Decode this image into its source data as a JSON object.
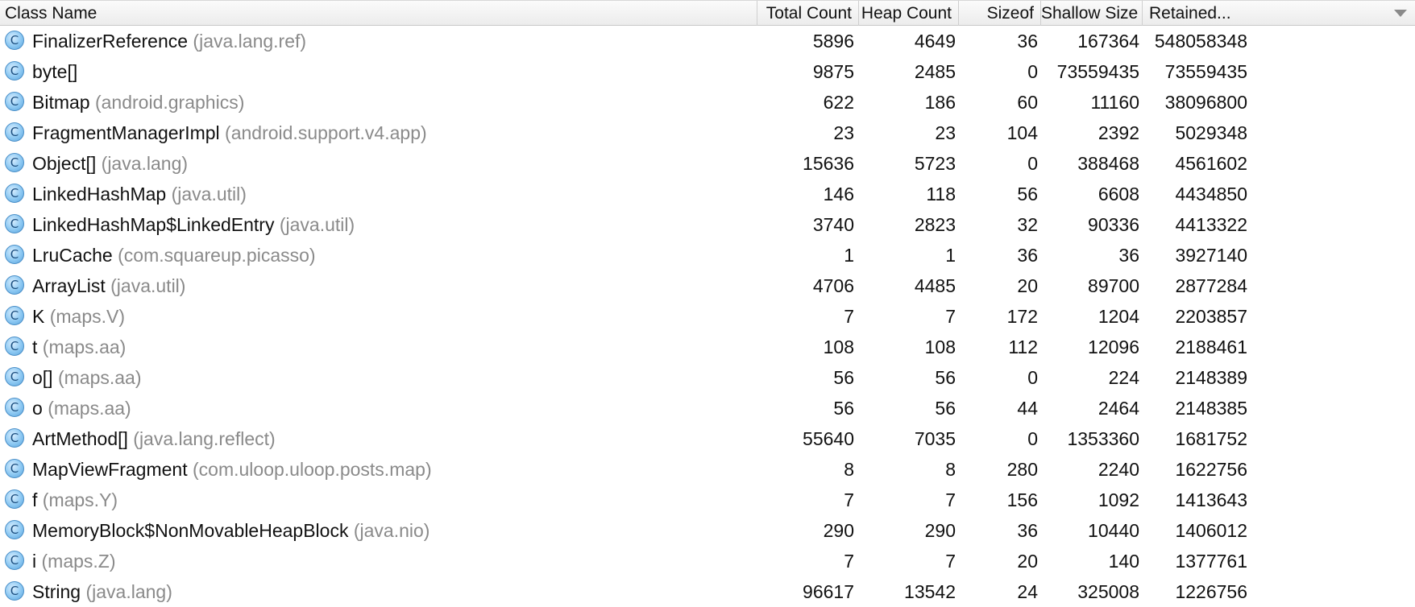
{
  "columns": {
    "class_name": "Class Name",
    "total_count": "Total Count",
    "heap_count": "Heap Count",
    "sizeof": "Sizeof",
    "shallow_size": "Shallow Size",
    "retained": "Retained..."
  },
  "class_icon_glyph": "C",
  "rows": [
    {
      "name": "FinalizerReference",
      "pkg": "(java.lang.ref)",
      "total": "5896",
      "heap": "4649",
      "sizeof": "36",
      "shallow": "167364",
      "retained": "548058348"
    },
    {
      "name": "byte[]",
      "pkg": "",
      "total": "9875",
      "heap": "2485",
      "sizeof": "0",
      "shallow": "73559435",
      "retained": "73559435"
    },
    {
      "name": "Bitmap",
      "pkg": "(android.graphics)",
      "total": "622",
      "heap": "186",
      "sizeof": "60",
      "shallow": "11160",
      "retained": "38096800"
    },
    {
      "name": "FragmentManagerImpl",
      "pkg": "(android.support.v4.app)",
      "total": "23",
      "heap": "23",
      "sizeof": "104",
      "shallow": "2392",
      "retained": "5029348"
    },
    {
      "name": "Object[]",
      "pkg": "(java.lang)",
      "total": "15636",
      "heap": "5723",
      "sizeof": "0",
      "shallow": "388468",
      "retained": "4561602"
    },
    {
      "name": "LinkedHashMap",
      "pkg": "(java.util)",
      "total": "146",
      "heap": "118",
      "sizeof": "56",
      "shallow": "6608",
      "retained": "4434850"
    },
    {
      "name": "LinkedHashMap$LinkedEntry",
      "pkg": "(java.util)",
      "total": "3740",
      "heap": "2823",
      "sizeof": "32",
      "shallow": "90336",
      "retained": "4413322"
    },
    {
      "name": "LruCache",
      "pkg": "(com.squareup.picasso)",
      "total": "1",
      "heap": "1",
      "sizeof": "36",
      "shallow": "36",
      "retained": "3927140"
    },
    {
      "name": "ArrayList",
      "pkg": "(java.util)",
      "total": "4706",
      "heap": "4485",
      "sizeof": "20",
      "shallow": "89700",
      "retained": "2877284"
    },
    {
      "name": "K",
      "pkg": "(maps.V)",
      "total": "7",
      "heap": "7",
      "sizeof": "172",
      "shallow": "1204",
      "retained": "2203857"
    },
    {
      "name": "t",
      "pkg": "(maps.aa)",
      "total": "108",
      "heap": "108",
      "sizeof": "112",
      "shallow": "12096",
      "retained": "2188461"
    },
    {
      "name": "o[]",
      "pkg": "(maps.aa)",
      "total": "56",
      "heap": "56",
      "sizeof": "0",
      "shallow": "224",
      "retained": "2148389"
    },
    {
      "name": "o",
      "pkg": "(maps.aa)",
      "total": "56",
      "heap": "56",
      "sizeof": "44",
      "shallow": "2464",
      "retained": "2148385"
    },
    {
      "name": "ArtMethod[]",
      "pkg": "(java.lang.reflect)",
      "total": "55640",
      "heap": "7035",
      "sizeof": "0",
      "shallow": "1353360",
      "retained": "1681752"
    },
    {
      "name": "MapViewFragment",
      "pkg": "(com.uloop.uloop.posts.map)",
      "total": "8",
      "heap": "8",
      "sizeof": "280",
      "shallow": "2240",
      "retained": "1622756"
    },
    {
      "name": "f",
      "pkg": "(maps.Y)",
      "total": "7",
      "heap": "7",
      "sizeof": "156",
      "shallow": "1092",
      "retained": "1413643"
    },
    {
      "name": "MemoryBlock$NonMovableHeapBlock",
      "pkg": "(java.nio)",
      "total": "290",
      "heap": "290",
      "sizeof": "36",
      "shallow": "10440",
      "retained": "1406012"
    },
    {
      "name": "i",
      "pkg": "(maps.Z)",
      "total": "7",
      "heap": "7",
      "sizeof": "20",
      "shallow": "140",
      "retained": "1377761"
    },
    {
      "name": "String",
      "pkg": "(java.lang)",
      "total": "96617",
      "heap": "13542",
      "sizeof": "24",
      "shallow": "325008",
      "retained": "1226756"
    }
  ]
}
